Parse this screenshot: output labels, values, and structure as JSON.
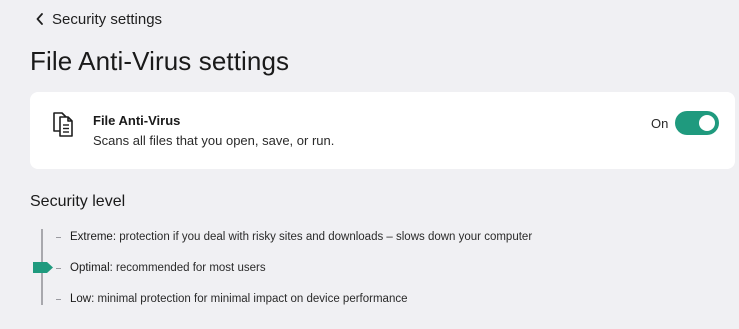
{
  "header": {
    "back_label": "Security settings",
    "page_title": "File Anti-Virus settings"
  },
  "card": {
    "title": "File Anti-Virus",
    "description": "Scans all files that you open, save, or run.",
    "toggle_label": "On",
    "toggle_on": true,
    "icon": "document-icon"
  },
  "security_level": {
    "title": "Security level",
    "selected": "Optimal",
    "levels": [
      {
        "name": "Extreme",
        "description": ": protection if you deal with risky sites and downloads – slows down your computer"
      },
      {
        "name": "Optimal",
        "description": ": recommended for most users"
      },
      {
        "name": "Low",
        "description": ": minimal protection for minimal impact on device performance"
      }
    ]
  },
  "colors": {
    "accent": "#1f9a7e",
    "background": "#f0f0f3",
    "card": "#ffffff"
  }
}
